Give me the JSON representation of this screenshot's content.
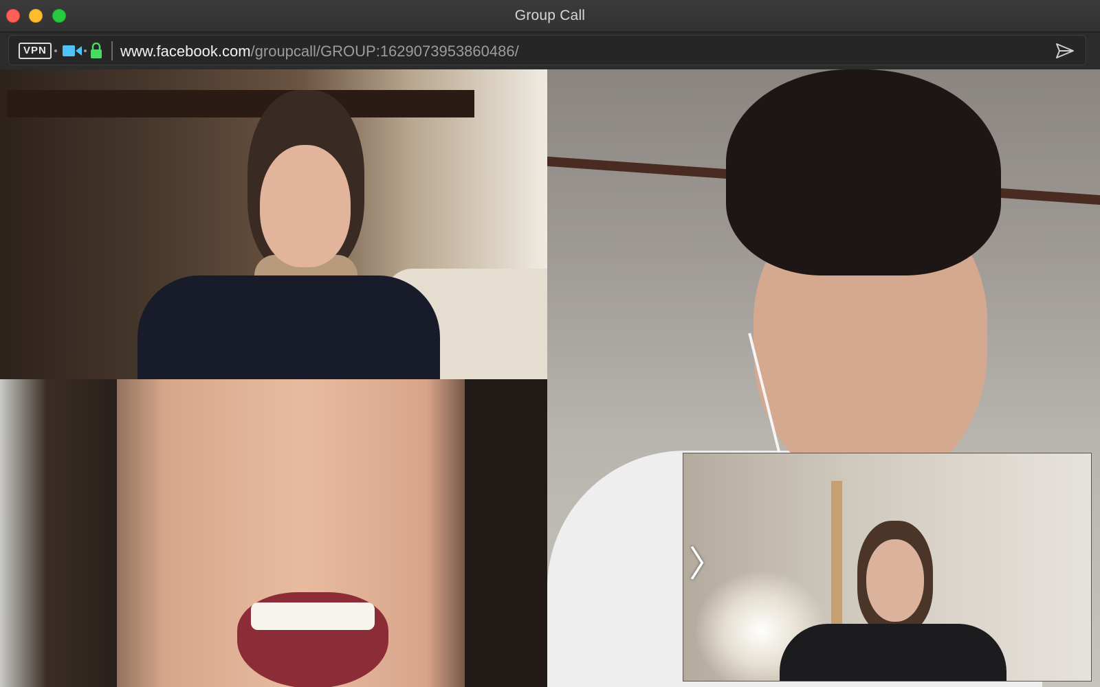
{
  "window": {
    "title": "Group Call"
  },
  "addressbar": {
    "vpn_label": "VPN",
    "url_domain": "www.facebook.com",
    "url_path": "/groupcall/GROUP:1629073953860486/"
  },
  "icons": {
    "camera": "video-camera-icon",
    "lock": "lock-icon",
    "send": "send-arrow-icon",
    "next": "chevron-right-icon"
  },
  "colors": {
    "close": "#fe5f57",
    "minimize": "#febc2e",
    "maximize": "#28c840",
    "camera": "#4fc3f7",
    "lock": "#4cd964"
  },
  "pip": {
    "arrow_glyph": "〉"
  }
}
